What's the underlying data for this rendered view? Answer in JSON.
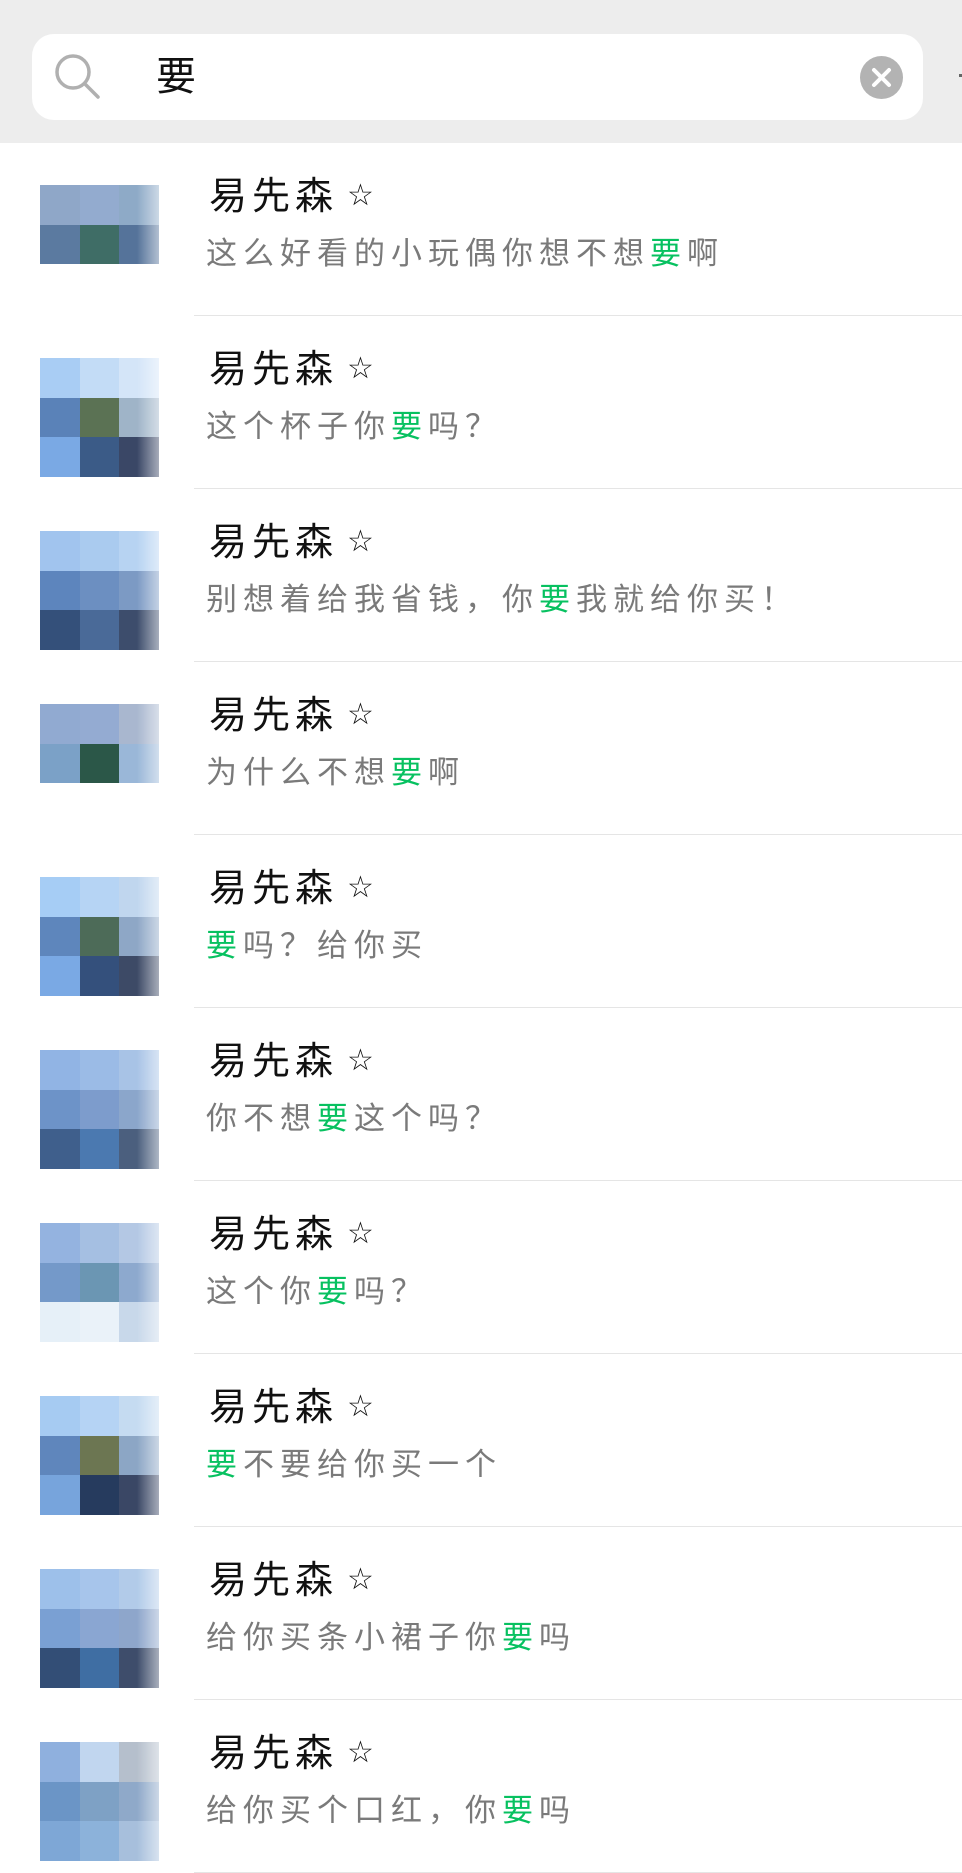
{
  "search": {
    "query": "要"
  },
  "colors": {
    "header_bg": "#ededed",
    "highlight": "#07c160",
    "message_text": "#7a7a7a",
    "name_text": "#111111",
    "clear_button": "#b3b3b3"
  },
  "results": [
    {
      "name": "易先森",
      "name_badge": "☆",
      "message_before": "这么好看的小玩偶你想不想",
      "message_match": "要",
      "message_after": "啊",
      "avatar": [
        "#8fa7c8",
        "#93abcf",
        "#8eaac7",
        "#5b7aa0",
        "#3f6d66",
        "#55739a",
        "#ffffff",
        "#ffffff",
        "#ffffff"
      ]
    },
    {
      "name": "易先森",
      "name_badge": "☆",
      "message_before": "这个杯子你",
      "message_match": "要",
      "message_after": "吗？",
      "avatar": [
        "#a9cdf4",
        "#c3dcf6",
        "#d4e5f8",
        "#5a82b8",
        "#5b7254",
        "#9fb4c8",
        "#7aa9e4",
        "#3b5b87",
        "#3a4766"
      ]
    },
    {
      "name": "易先森",
      "name_badge": "☆",
      "message_before": "别想着给我省钱，你",
      "message_match": "要",
      "message_after": "我就给你买！",
      "avatar": [
        "#a1c4ee",
        "#aacbef",
        "#b7d3f2",
        "#5d85bd",
        "#6c8fc1",
        "#7c9ac4",
        "#34507a",
        "#4a6a98",
        "#3d4d6c"
      ]
    },
    {
      "name": "易先森",
      "name_badge": "☆",
      "message_before": "为什么不想",
      "message_match": "要",
      "message_after": "啊",
      "avatar": [
        "#91aad1",
        "#94abd2",
        "#a9b7cf",
        "#7ba1c7",
        "#2b5748",
        "#9ab7d8",
        "#ffffff",
        "#ffffff",
        "#ffffff"
      ]
    },
    {
      "name": "易先森",
      "name_badge": "☆",
      "message_before": "",
      "message_match": "要",
      "message_after": "吗？给你买",
      "avatar": [
        "#a6cdf5",
        "#b6d4f4",
        "#c0d6ee",
        "#5e86bc",
        "#4d6b58",
        "#8ea7c6",
        "#7aa9e4",
        "#34507c",
        "#3d4a66"
      ]
    },
    {
      "name": "易先森",
      "name_badge": "☆",
      "message_before": "你不想",
      "message_match": "要",
      "message_after": "这个吗？",
      "avatar": [
        "#91b4e4",
        "#9bbbe6",
        "#a8c3e6",
        "#6d93c8",
        "#7d9ccc",
        "#8ba6cb",
        "#3f5f8c",
        "#4b79b0",
        "#4b5f7e"
      ]
    },
    {
      "name": "易先森",
      "name_badge": "☆",
      "message_before": "这个你",
      "message_match": "要",
      "message_after": "吗？",
      "avatar": [
        "#94b3e0",
        "#a5bfe2",
        "#b4c8e4",
        "#7499c9",
        "#6b96b3",
        "#8da9ce",
        "#e6f0f8",
        "#eaf2f9",
        "#c8d8ea"
      ]
    },
    {
      "name": "易先森",
      "name_badge": "☆",
      "message_before": "",
      "message_match": "要",
      "message_after": "不要给你买一个",
      "avatar": [
        "#a6cbf2",
        "#b5d3f4",
        "#c5dbf1",
        "#5f86bc",
        "#6c7652",
        "#8ca6c5",
        "#77a4dc",
        "#263b5e",
        "#3a4765"
      ]
    },
    {
      "name": "易先森",
      "name_badge": "☆",
      "message_before": "给你买条小裙子你",
      "message_match": "要",
      "message_after": "吗",
      "avatar": [
        "#9dc0ea",
        "#a7c5eb",
        "#b2cbe9",
        "#7aa0d3",
        "#8aa6d2",
        "#8ea6cb",
        "#334e76",
        "#3f6ea3",
        "#3e4d6b"
      ]
    },
    {
      "name": "易先森",
      "name_badge": "☆",
      "message_before": "给你买个口红，你",
      "message_match": "要",
      "message_after": "吗",
      "avatar": [
        "#8fb0de",
        "#c1d6ef",
        "#b5bfcc",
        "#6b95c6",
        "#7ea1c5",
        "#8fa9c9",
        "#7ea7d6",
        "#8cb2da",
        "#a7bfdc"
      ]
    }
  ]
}
